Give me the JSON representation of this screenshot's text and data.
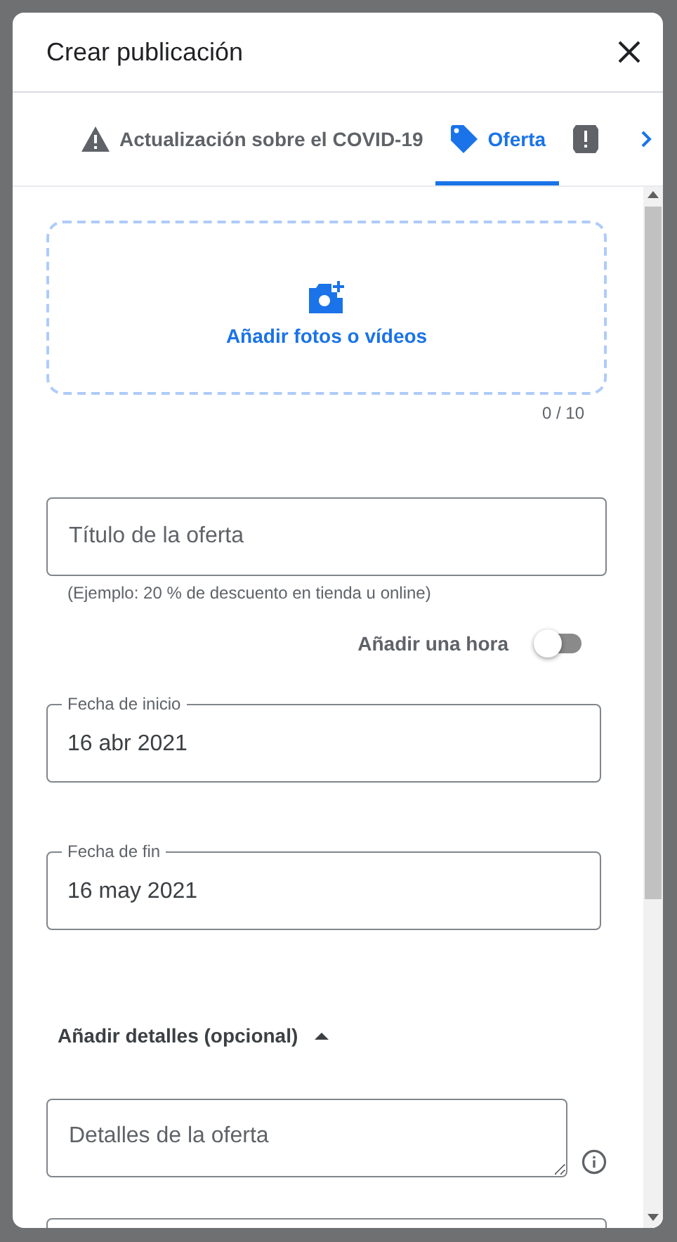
{
  "dialog": {
    "title": "Crear publicación"
  },
  "tabs": [
    {
      "kind": "warning",
      "label": "Actualización sobre el COVID-19",
      "selected": false
    },
    {
      "kind": "tag",
      "label": "Oferta",
      "selected": true
    },
    {
      "kind": "alert",
      "selected": false
    }
  ],
  "upload": {
    "label": "Añadir fotos o vídeos",
    "counter": "0 / 10"
  },
  "title_field": {
    "placeholder": "Título de la oferta",
    "helper": "(Ejemplo: 20 % de descuento en tienda u online)"
  },
  "time_toggle": {
    "label": "Añadir una hora",
    "on": false
  },
  "dates": [
    {
      "label": "Fecha de inicio",
      "value": "16 abr 2021"
    },
    {
      "label": "Fecha de fin",
      "value": "16 may 2021"
    }
  ],
  "details": {
    "label": "Añadir detalles (opcional)",
    "expanded": true,
    "placeholder": "Detalles de la oferta"
  }
}
